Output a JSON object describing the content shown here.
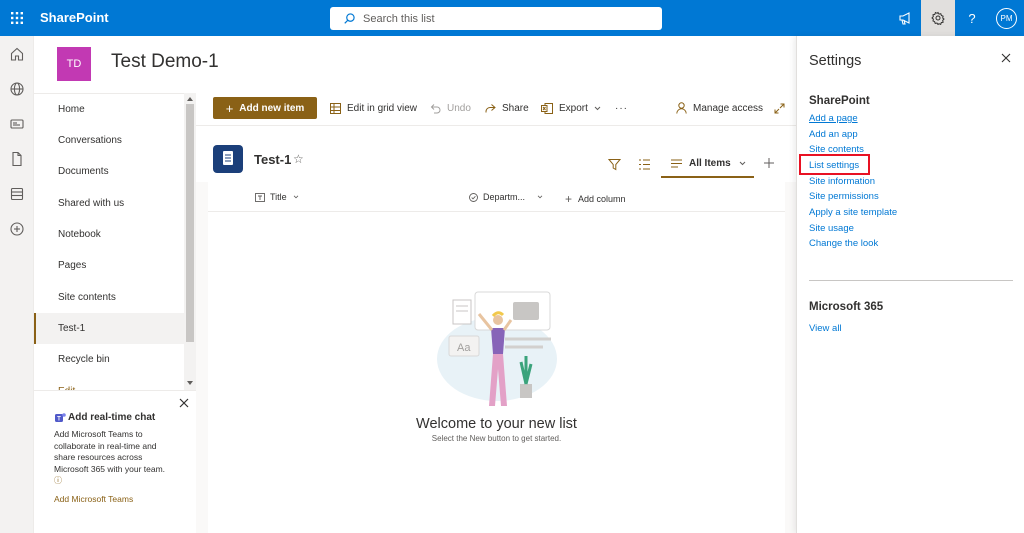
{
  "topbar": {
    "brand": "SharePoint",
    "search_placeholder": "Search this list",
    "avatar_initials": "PM",
    "help_label": "?",
    "color": "#0078d4"
  },
  "site": {
    "logo_initials": "TD",
    "logo_color": "#c239b3",
    "title": "Test Demo-1"
  },
  "nav": {
    "items": [
      {
        "label": "Home"
      },
      {
        "label": "Conversations"
      },
      {
        "label": "Documents"
      },
      {
        "label": "Shared with us"
      },
      {
        "label": "Notebook"
      },
      {
        "label": "Pages"
      },
      {
        "label": "Site contents"
      },
      {
        "label": "Test-1",
        "selected": true
      },
      {
        "label": "Recycle bin"
      },
      {
        "label": "Edit"
      }
    ]
  },
  "teams_card": {
    "title": "Add real-time chat",
    "description": "Add Microsoft Teams to collaborate in real-time and share resources across Microsoft 365 with your team.",
    "link": "Add Microsoft Teams"
  },
  "commands": {
    "add_new_item": "Add new item",
    "edit_grid": "Edit in grid view",
    "undo": "Undo",
    "share": "Share",
    "export": "Export",
    "more": "···",
    "manage_access": "Manage access",
    "accent": "#8a6116"
  },
  "list": {
    "title": "Test-1",
    "view": "All Items",
    "columns": [
      "Title",
      "Departm...",
      "Add column"
    ],
    "welcome_title": "Welcome to your new list",
    "welcome_sub": "Select the New button to get started."
  },
  "settings_pane": {
    "title": "Settings",
    "sharepoint_heading": "SharePoint",
    "links": [
      "Add a page",
      "Add an app",
      "Site contents",
      "List settings",
      "Site information",
      "Site permissions",
      "Apply a site template",
      "Site usage",
      "Change the look"
    ],
    "highlighted_link": "List settings",
    "highlight_color": "#e81123",
    "m365_heading": "Microsoft 365",
    "view_all": "View all"
  }
}
